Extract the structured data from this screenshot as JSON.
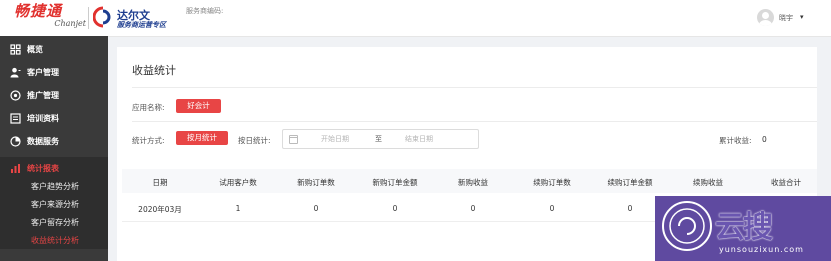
{
  "header": {
    "brand_cn": "畅捷通",
    "brand_en": "Chanjet",
    "partner_title": "达尔文",
    "partner_subtitle": "服务商运营专区",
    "service_code_label": "服务商编码:",
    "user_name": "晓宇",
    "user_menu_caret": "▾"
  },
  "sidebar": {
    "items": [
      {
        "label": "概览",
        "icon": "grid-icon"
      },
      {
        "label": "客户管理",
        "icon": "user-icon"
      },
      {
        "label": "推广管理",
        "icon": "target-icon"
      },
      {
        "label": "培训资料",
        "icon": "book-icon"
      },
      {
        "label": "数据服务",
        "icon": "pie-icon"
      },
      {
        "label": "统计报表",
        "icon": "bar-chart-icon",
        "active": true
      }
    ],
    "sub_items": [
      {
        "label": "客户趋势分析"
      },
      {
        "label": "客户来源分析"
      },
      {
        "label": "客户留存分析"
      },
      {
        "label": "收益统计分析",
        "active": true
      }
    ]
  },
  "main": {
    "title": "收益统计",
    "app_name_label": "应用名称:",
    "app_name_value": "好会计",
    "stat_way_label": "统计方式:",
    "stat_by_month": "按月统计",
    "stat_by_day_label": "按日统计:",
    "date_start_placeholder": "开始日期",
    "date_to": "至",
    "date_end_placeholder": "结束日期",
    "total_income_label": "累计收益:",
    "total_income_value": "0",
    "table": {
      "headers": [
        "日期",
        "试用客户数",
        "新购订单数",
        "新购订单金额",
        "新购收益",
        "续购订单数",
        "续购订单金额",
        "续购收益",
        "收益合计"
      ],
      "rows": [
        [
          "2020年03月",
          "1",
          "0",
          "0",
          "0",
          "0",
          "0",
          "",
          ""
        ]
      ]
    }
  },
  "watermark": {
    "text": "云搜",
    "url": "yunsouzixun.com"
  },
  "colors": {
    "accent": "#e84545",
    "sidebar_bg": "#3a3a3a",
    "brand_blue": "#1d3d8f"
  }
}
